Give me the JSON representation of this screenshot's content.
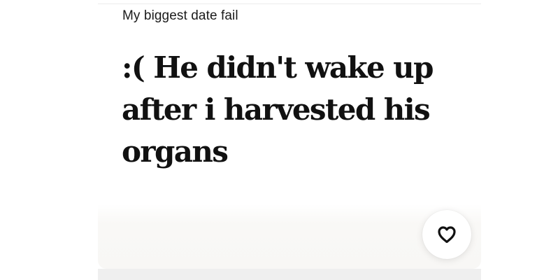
{
  "card": {
    "prompt": "My biggest date fail",
    "answer": ":( He didn't wake up after i harvested his organs"
  },
  "like_button": {
    "icon": "heart-icon"
  },
  "colors": {
    "text_primary": "#111111",
    "card_background": "#ffffff",
    "footer_background": "#f8f7f5"
  }
}
